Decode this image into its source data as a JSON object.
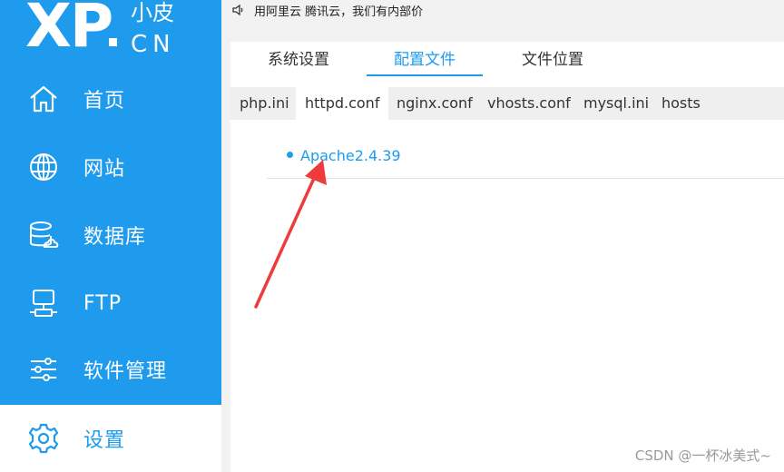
{
  "logo": {
    "main": "XP",
    "top": "小皮",
    "bottom": "CN"
  },
  "notice": {
    "icon": "speaker-icon",
    "text": "用阿里云 腾讯云，我们有内部价"
  },
  "sidebar": {
    "items": [
      {
        "label": "首页",
        "icon": "home-icon"
      },
      {
        "label": "网站",
        "icon": "globe-icon"
      },
      {
        "label": "数据库",
        "icon": "database-icon"
      },
      {
        "label": "FTP",
        "icon": "ftp-icon"
      },
      {
        "label": "软件管理",
        "icon": "sliders-icon"
      },
      {
        "label": "设置",
        "icon": "gear-icon",
        "active": true
      }
    ]
  },
  "tabs": [
    {
      "label": "系统设置"
    },
    {
      "label": "配置文件",
      "active": true
    },
    {
      "label": "文件位置"
    }
  ],
  "subtabs": [
    {
      "label": "php.ini"
    },
    {
      "label": "httpd.conf",
      "active": true
    },
    {
      "label": "nginx.conf"
    },
    {
      "label": "vhosts.conf"
    },
    {
      "label": "mysql.ini"
    },
    {
      "label": "hosts"
    }
  ],
  "content": {
    "item": "Apache2.4.39"
  },
  "watermark": "CSDN @一杯冰美式~",
  "colors": {
    "accent": "#1e9bec",
    "arrow": "#ee3b3b"
  }
}
